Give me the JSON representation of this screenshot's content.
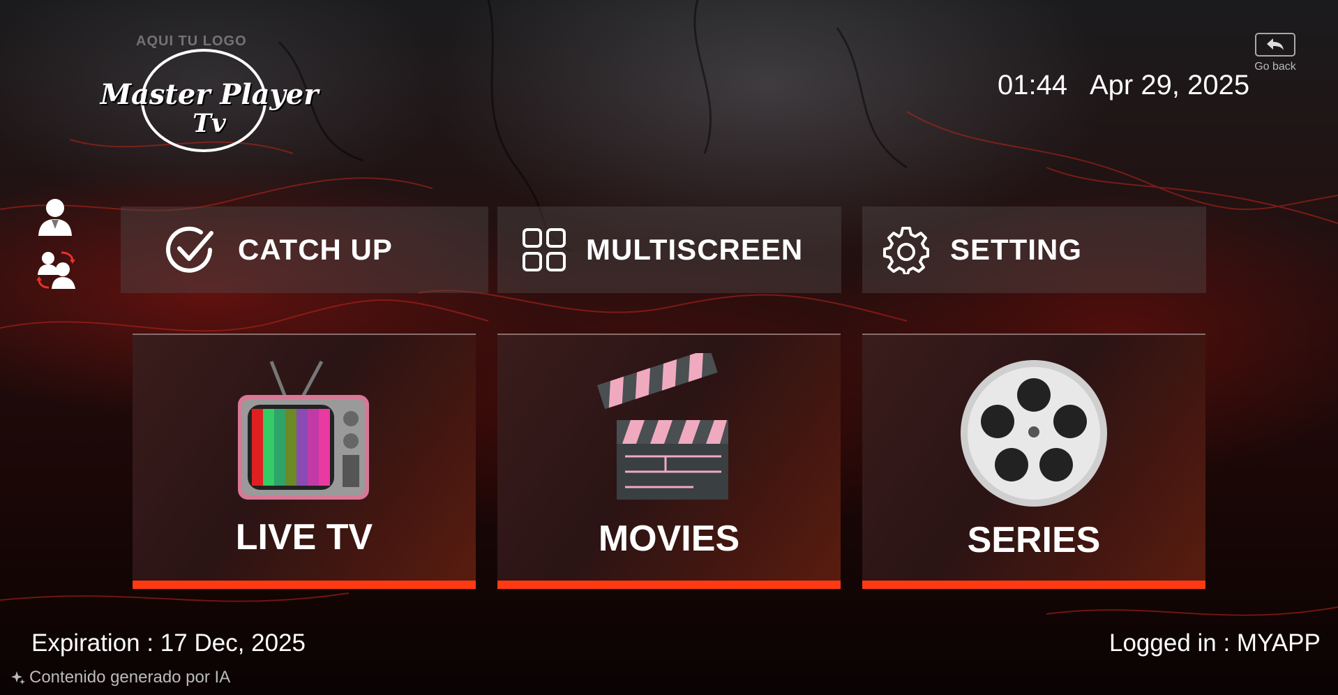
{
  "logo": {
    "tagline": "AQUI TU LOGO",
    "name_line1": "Master Player",
    "name_line2": "Tv"
  },
  "header": {
    "time": "01:44",
    "date": "Apr 29, 2025",
    "go_back_label": "Go back"
  },
  "side_icons": [
    "user-icon",
    "switch-user-icon"
  ],
  "top_tiles": [
    {
      "label": "CATCH UP",
      "icon": "check-circle-icon"
    },
    {
      "label": "MULTISCREEN",
      "icon": "grid-icon"
    },
    {
      "label": "SETTING",
      "icon": "gear-icon"
    }
  ],
  "main_tiles": [
    {
      "label": "LIVE TV",
      "icon": "tv-icon"
    },
    {
      "label": "MOVIES",
      "icon": "clapperboard-icon"
    },
    {
      "label": "SERIES",
      "icon": "film-reel-icon"
    }
  ],
  "footer": {
    "expiration": "Expiration : 17 Dec, 2025",
    "logged_in": "Logged in : MYAPP",
    "ai_note": "Contenido generado por IA"
  },
  "colors": {
    "accent": "#ff3a12",
    "tile_bg": "#2b1414",
    "top_tile_bg": "#504646"
  }
}
